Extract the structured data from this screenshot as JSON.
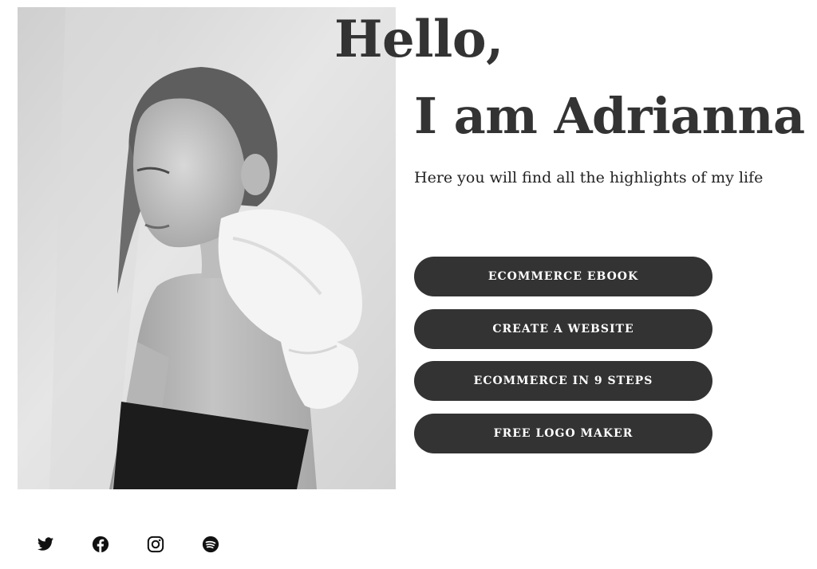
{
  "hero": {
    "greeting": "Hello,",
    "name": "I am Adrianna",
    "tagline": "Here you will find all the highlights of my life",
    "photo": "black-and-white portrait of a woman with a white bow on her shoulder"
  },
  "links": [
    {
      "label": "ECOMMERCE EBOOK"
    },
    {
      "label": "CREATE A WEBSITE"
    },
    {
      "label": "ECOMMERCE IN 9 STEPS"
    },
    {
      "label": "FREE LOGO MAKER"
    }
  ],
  "social": [
    {
      "icon": "twitter-icon"
    },
    {
      "icon": "facebook-icon"
    },
    {
      "icon": "instagram-icon"
    },
    {
      "icon": "spotify-icon"
    }
  ],
  "colors": {
    "button": "#333333",
    "button_text": "#ffffff",
    "heading": "#333333",
    "background": "#ffffff"
  }
}
